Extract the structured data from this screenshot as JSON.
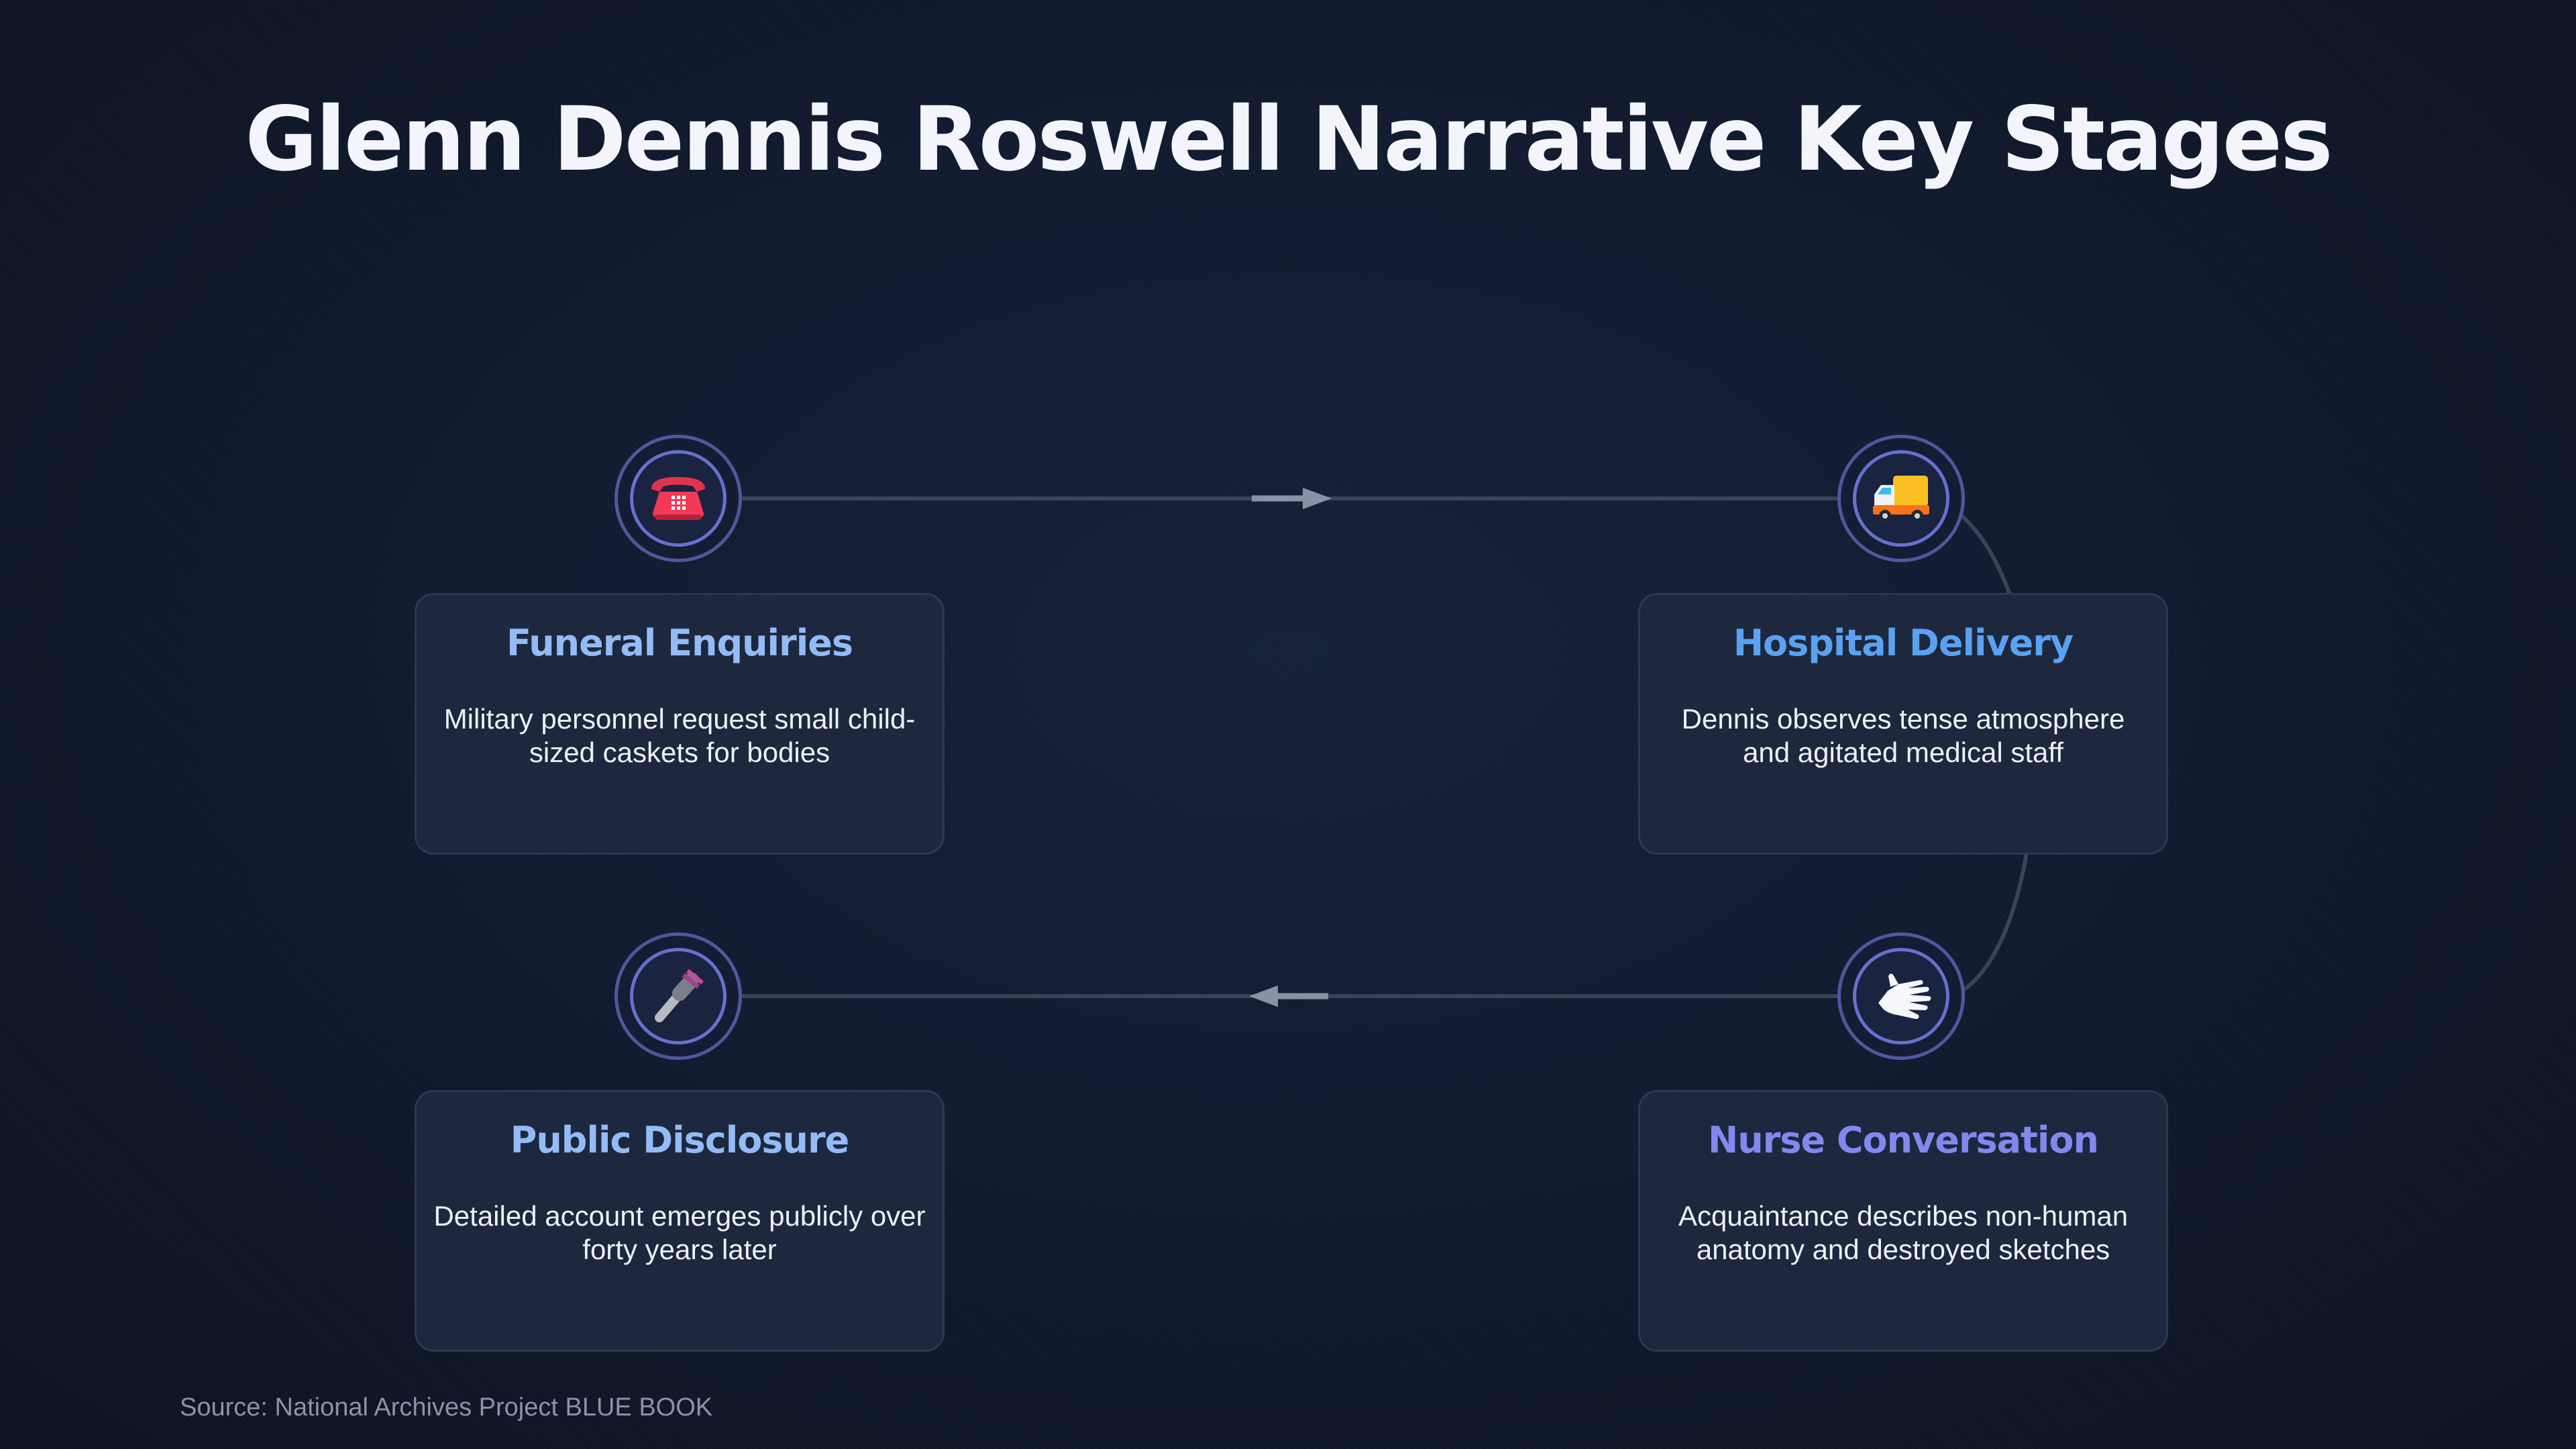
{
  "title": "Glenn Dennis Roswell Narrative Key Stages",
  "stages": [
    {
      "title": "Funeral Enquiries",
      "description": "Military personnel request small child-sized caskets for bodies",
      "icon": "telephone-icon",
      "title_color": "#93bbf7"
    },
    {
      "title": "Hospital Delivery",
      "description": "Dennis observes tense atmosphere and agitated medical staff",
      "icon": "delivery-truck-icon",
      "title_color": "#5aa2f1"
    },
    {
      "title": "Nurse Conversation",
      "description": "Acquaintance describes non-human anatomy and destroyed sketches",
      "icon": "hand-icon",
      "title_color": "#8288ee"
    },
    {
      "title": "Public Disclosure",
      "description": "Detailed account emerges publicly over forty years later",
      "icon": "microphone-icon",
      "title_color": "#93bbf7"
    }
  ],
  "source": "Source: National Archives Project BLUE BOOK",
  "colors": {
    "background": "#111a2e",
    "card": "#1d283f",
    "node_ring": "#7c83f2",
    "connector": "#3a4458",
    "arrow": "#8a93a6"
  }
}
